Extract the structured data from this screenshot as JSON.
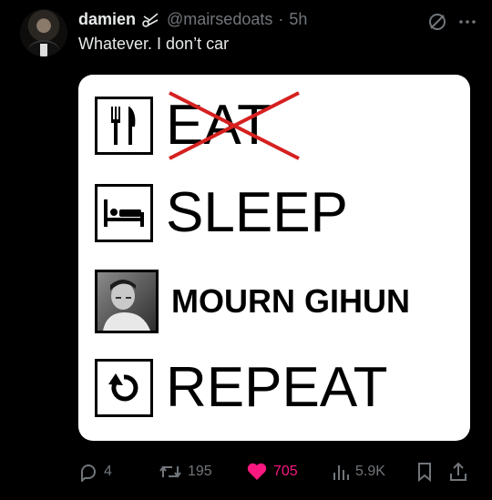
{
  "tweet": {
    "display_name": "damien",
    "handle": "@mairsedoats",
    "separator": "·",
    "time": "5h",
    "text": "Whatever. I don’t car"
  },
  "meme": {
    "rows": [
      {
        "word": "EAT",
        "icon": "fork-knife-icon",
        "struck": true
      },
      {
        "word": "SLEEP",
        "icon": "bed-icon"
      },
      {
        "word": "MOURN GIHUN",
        "icon": "man-photo"
      },
      {
        "word": "REPEAT",
        "icon": "loop-arrow-icon"
      }
    ]
  },
  "actions": {
    "replies": "4",
    "reposts": "195",
    "likes": "705",
    "views": "5.9K"
  },
  "colors": {
    "background": "#000000",
    "muted": "#71767b",
    "like": "#f91880",
    "strike": "#d62020"
  }
}
